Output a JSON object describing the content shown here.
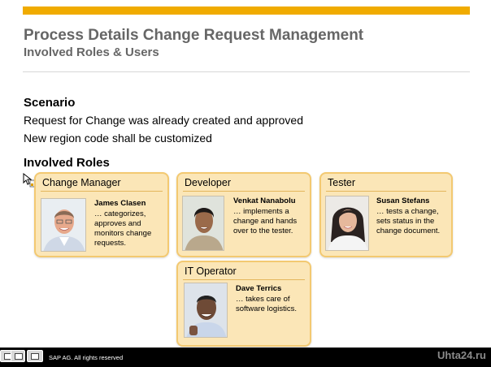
{
  "header": {
    "title": "Process Details Change Request Management",
    "subtitle": "Involved Roles & Users"
  },
  "scenario": {
    "heading": "Scenario",
    "lines": [
      "Request for Change was already created and approved",
      "New region code shall be customized"
    ]
  },
  "roles": {
    "heading": "Involved Roles",
    "cards": [
      {
        "role": "Change Manager",
        "name": "James Clasen",
        "description": "… categorizes, approves and monitors change requests."
      },
      {
        "role": "Developer",
        "name": "Venkat Nanabolu",
        "description": "… implements a change and hands over to the tester."
      },
      {
        "role": "Tester",
        "name": "Susan Stefans",
        "description": "… tests a change, sets status in the change document."
      },
      {
        "role": "IT Operator",
        "name": "Dave Terrics",
        "description": "… takes care of software logistics."
      }
    ]
  },
  "footer": {
    "copyright": "SAP AG. All rights reserved",
    "watermark": "Uhta24.ru"
  },
  "colors": {
    "accent_bar": "#f0ab00",
    "card_fill": "#fbe6b7",
    "card_border": "#f3c971",
    "title_gray": "#666666"
  },
  "icons": [
    "cursor-icon",
    "person-photo-icon",
    "nav-button-icon"
  ]
}
